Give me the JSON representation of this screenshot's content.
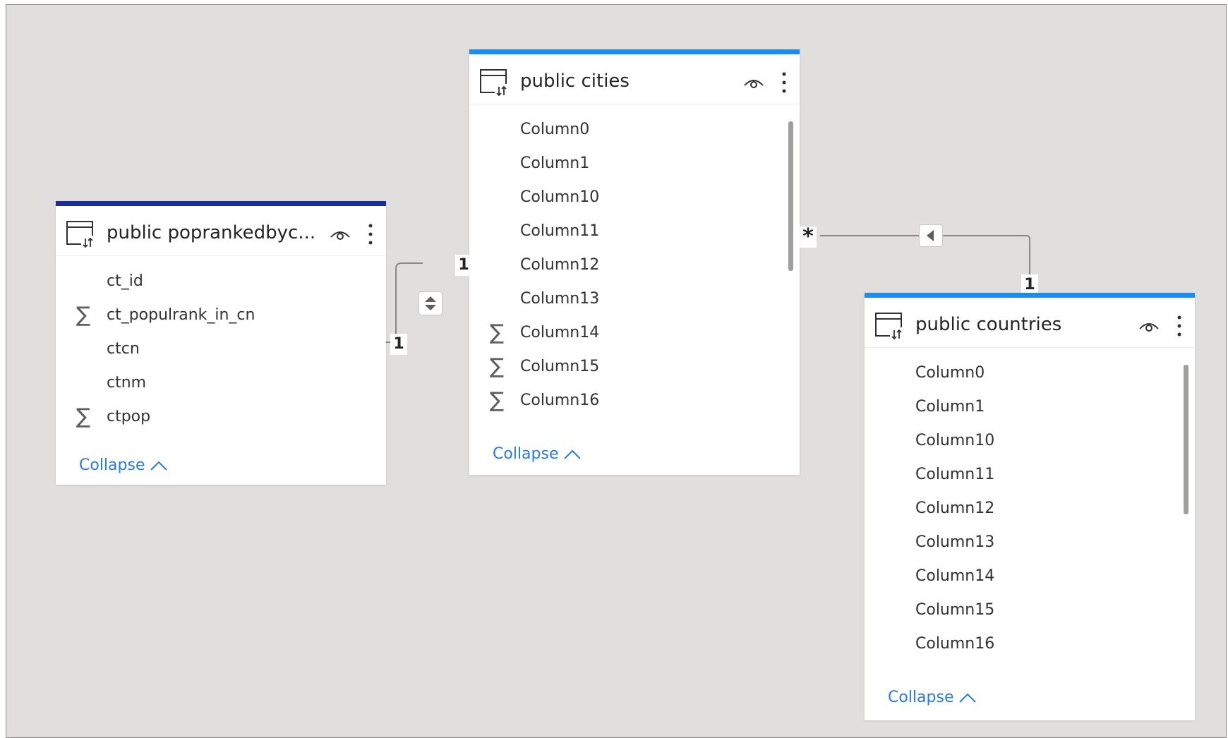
{
  "colors": {
    "canvas": "#e1dfdd",
    "accent_dark": "#1b2d9b",
    "accent_blue": "#1b8cf0",
    "link": "#2b7cd3"
  },
  "tables": {
    "poprank": {
      "title": "public poprankedbyc...",
      "fields": [
        {
          "name": "ct_id",
          "icon": ""
        },
        {
          "name": "ct_populrank_in_cn",
          "icon": "sigma"
        },
        {
          "name": "ctcn",
          "icon": ""
        },
        {
          "name": "ctnm",
          "icon": ""
        },
        {
          "name": "ctpop",
          "icon": "sigma"
        }
      ],
      "collapse_label": "Collapse"
    },
    "cities": {
      "title": "public cities",
      "fields": [
        {
          "name": "Column0",
          "icon": ""
        },
        {
          "name": "Column1",
          "icon": ""
        },
        {
          "name": "Column10",
          "icon": ""
        },
        {
          "name": "Column11",
          "icon": ""
        },
        {
          "name": "Column12",
          "icon": ""
        },
        {
          "name": "Column13",
          "icon": ""
        },
        {
          "name": "Column14",
          "icon": "sigma"
        },
        {
          "name": "Column15",
          "icon": "sigma"
        },
        {
          "name": "Column16",
          "icon": "sigma"
        }
      ],
      "collapse_label": "Collapse"
    },
    "countries": {
      "title": "public countries",
      "fields": [
        {
          "name": "Column0",
          "icon": ""
        },
        {
          "name": "Column1",
          "icon": ""
        },
        {
          "name": "Column10",
          "icon": ""
        },
        {
          "name": "Column11",
          "icon": ""
        },
        {
          "name": "Column12",
          "icon": ""
        },
        {
          "name": "Column13",
          "icon": ""
        },
        {
          "name": "Column14",
          "icon": ""
        },
        {
          "name": "Column15",
          "icon": ""
        },
        {
          "name": "Column16",
          "icon": ""
        }
      ],
      "collapse_label": "Collapse"
    }
  },
  "relationships": {
    "poprank_cities": {
      "from_label": "1",
      "to_label": "1"
    },
    "cities_countries": {
      "from_label": "*",
      "to_label": "1"
    }
  }
}
